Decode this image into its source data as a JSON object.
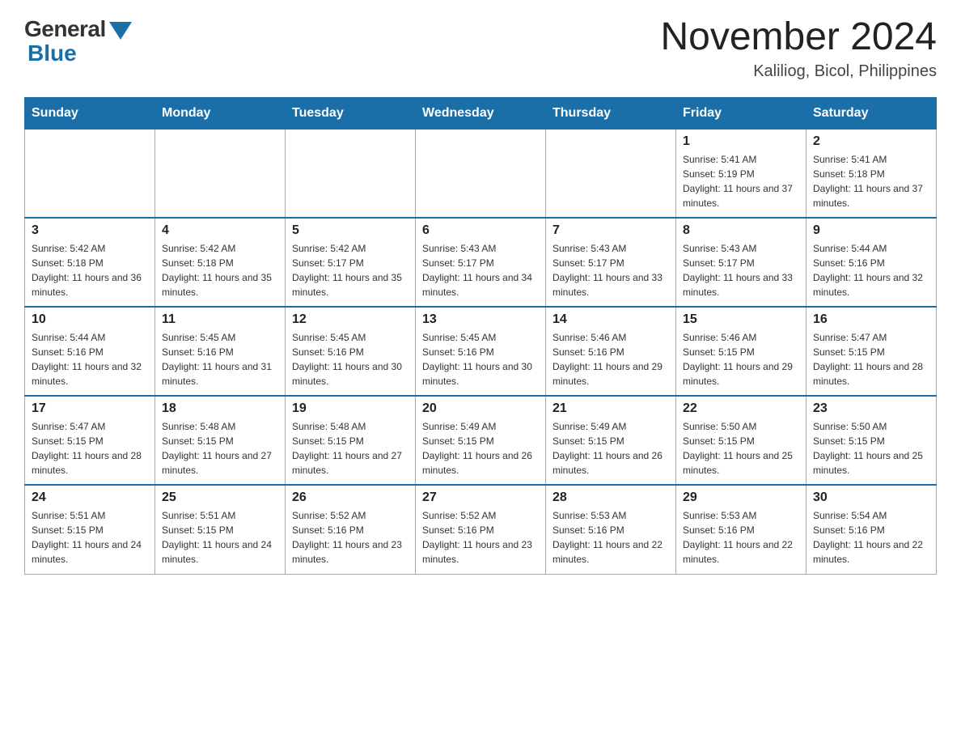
{
  "logo": {
    "general": "General",
    "blue": "Blue"
  },
  "title": {
    "month_year": "November 2024",
    "location": "Kaliliog, Bicol, Philippines"
  },
  "days_of_week": [
    "Sunday",
    "Monday",
    "Tuesday",
    "Wednesday",
    "Thursday",
    "Friday",
    "Saturday"
  ],
  "weeks": [
    [
      {
        "day": "",
        "sunrise": "",
        "sunset": "",
        "daylight": ""
      },
      {
        "day": "",
        "sunrise": "",
        "sunset": "",
        "daylight": ""
      },
      {
        "day": "",
        "sunrise": "",
        "sunset": "",
        "daylight": ""
      },
      {
        "day": "",
        "sunrise": "",
        "sunset": "",
        "daylight": ""
      },
      {
        "day": "",
        "sunrise": "",
        "sunset": "",
        "daylight": ""
      },
      {
        "day": "1",
        "sunrise": "Sunrise: 5:41 AM",
        "sunset": "Sunset: 5:19 PM",
        "daylight": "Daylight: 11 hours and 37 minutes."
      },
      {
        "day": "2",
        "sunrise": "Sunrise: 5:41 AM",
        "sunset": "Sunset: 5:18 PM",
        "daylight": "Daylight: 11 hours and 37 minutes."
      }
    ],
    [
      {
        "day": "3",
        "sunrise": "Sunrise: 5:42 AM",
        "sunset": "Sunset: 5:18 PM",
        "daylight": "Daylight: 11 hours and 36 minutes."
      },
      {
        "day": "4",
        "sunrise": "Sunrise: 5:42 AM",
        "sunset": "Sunset: 5:18 PM",
        "daylight": "Daylight: 11 hours and 35 minutes."
      },
      {
        "day": "5",
        "sunrise": "Sunrise: 5:42 AM",
        "sunset": "Sunset: 5:17 PM",
        "daylight": "Daylight: 11 hours and 35 minutes."
      },
      {
        "day": "6",
        "sunrise": "Sunrise: 5:43 AM",
        "sunset": "Sunset: 5:17 PM",
        "daylight": "Daylight: 11 hours and 34 minutes."
      },
      {
        "day": "7",
        "sunrise": "Sunrise: 5:43 AM",
        "sunset": "Sunset: 5:17 PM",
        "daylight": "Daylight: 11 hours and 33 minutes."
      },
      {
        "day": "8",
        "sunrise": "Sunrise: 5:43 AM",
        "sunset": "Sunset: 5:17 PM",
        "daylight": "Daylight: 11 hours and 33 minutes."
      },
      {
        "day": "9",
        "sunrise": "Sunrise: 5:44 AM",
        "sunset": "Sunset: 5:16 PM",
        "daylight": "Daylight: 11 hours and 32 minutes."
      }
    ],
    [
      {
        "day": "10",
        "sunrise": "Sunrise: 5:44 AM",
        "sunset": "Sunset: 5:16 PM",
        "daylight": "Daylight: 11 hours and 32 minutes."
      },
      {
        "day": "11",
        "sunrise": "Sunrise: 5:45 AM",
        "sunset": "Sunset: 5:16 PM",
        "daylight": "Daylight: 11 hours and 31 minutes."
      },
      {
        "day": "12",
        "sunrise": "Sunrise: 5:45 AM",
        "sunset": "Sunset: 5:16 PM",
        "daylight": "Daylight: 11 hours and 30 minutes."
      },
      {
        "day": "13",
        "sunrise": "Sunrise: 5:45 AM",
        "sunset": "Sunset: 5:16 PM",
        "daylight": "Daylight: 11 hours and 30 minutes."
      },
      {
        "day": "14",
        "sunrise": "Sunrise: 5:46 AM",
        "sunset": "Sunset: 5:16 PM",
        "daylight": "Daylight: 11 hours and 29 minutes."
      },
      {
        "day": "15",
        "sunrise": "Sunrise: 5:46 AM",
        "sunset": "Sunset: 5:15 PM",
        "daylight": "Daylight: 11 hours and 29 minutes."
      },
      {
        "day": "16",
        "sunrise": "Sunrise: 5:47 AM",
        "sunset": "Sunset: 5:15 PM",
        "daylight": "Daylight: 11 hours and 28 minutes."
      }
    ],
    [
      {
        "day": "17",
        "sunrise": "Sunrise: 5:47 AM",
        "sunset": "Sunset: 5:15 PM",
        "daylight": "Daylight: 11 hours and 28 minutes."
      },
      {
        "day": "18",
        "sunrise": "Sunrise: 5:48 AM",
        "sunset": "Sunset: 5:15 PM",
        "daylight": "Daylight: 11 hours and 27 minutes."
      },
      {
        "day": "19",
        "sunrise": "Sunrise: 5:48 AM",
        "sunset": "Sunset: 5:15 PM",
        "daylight": "Daylight: 11 hours and 27 minutes."
      },
      {
        "day": "20",
        "sunrise": "Sunrise: 5:49 AM",
        "sunset": "Sunset: 5:15 PM",
        "daylight": "Daylight: 11 hours and 26 minutes."
      },
      {
        "day": "21",
        "sunrise": "Sunrise: 5:49 AM",
        "sunset": "Sunset: 5:15 PM",
        "daylight": "Daylight: 11 hours and 26 minutes."
      },
      {
        "day": "22",
        "sunrise": "Sunrise: 5:50 AM",
        "sunset": "Sunset: 5:15 PM",
        "daylight": "Daylight: 11 hours and 25 minutes."
      },
      {
        "day": "23",
        "sunrise": "Sunrise: 5:50 AM",
        "sunset": "Sunset: 5:15 PM",
        "daylight": "Daylight: 11 hours and 25 minutes."
      }
    ],
    [
      {
        "day": "24",
        "sunrise": "Sunrise: 5:51 AM",
        "sunset": "Sunset: 5:15 PM",
        "daylight": "Daylight: 11 hours and 24 minutes."
      },
      {
        "day": "25",
        "sunrise": "Sunrise: 5:51 AM",
        "sunset": "Sunset: 5:15 PM",
        "daylight": "Daylight: 11 hours and 24 minutes."
      },
      {
        "day": "26",
        "sunrise": "Sunrise: 5:52 AM",
        "sunset": "Sunset: 5:16 PM",
        "daylight": "Daylight: 11 hours and 23 minutes."
      },
      {
        "day": "27",
        "sunrise": "Sunrise: 5:52 AM",
        "sunset": "Sunset: 5:16 PM",
        "daylight": "Daylight: 11 hours and 23 minutes."
      },
      {
        "day": "28",
        "sunrise": "Sunrise: 5:53 AM",
        "sunset": "Sunset: 5:16 PM",
        "daylight": "Daylight: 11 hours and 22 minutes."
      },
      {
        "day": "29",
        "sunrise": "Sunrise: 5:53 AM",
        "sunset": "Sunset: 5:16 PM",
        "daylight": "Daylight: 11 hours and 22 minutes."
      },
      {
        "day": "30",
        "sunrise": "Sunrise: 5:54 AM",
        "sunset": "Sunset: 5:16 PM",
        "daylight": "Daylight: 11 hours and 22 minutes."
      }
    ]
  ]
}
